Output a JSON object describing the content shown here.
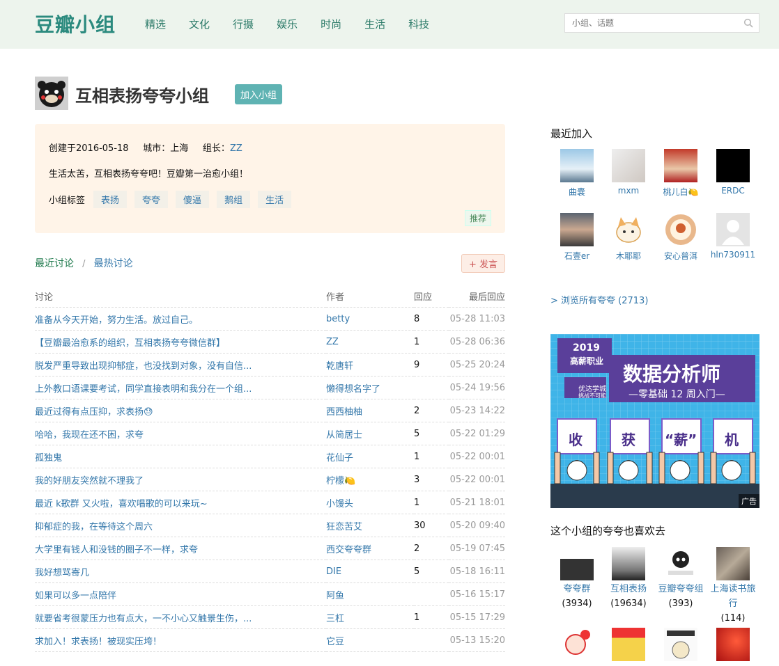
{
  "header": {
    "logo": "豆瓣小组",
    "nav": [
      "精选",
      "文化",
      "行摄",
      "娱乐",
      "时尚",
      "生活",
      "科技"
    ],
    "search_placeholder": "小组、话题"
  },
  "group": {
    "title": "互相表扬夸夸小组",
    "join_label": "加入小组",
    "created_label": "创建于2016-05-18",
    "city_label": "城市：上海",
    "leader_label": "组长：",
    "leader_name": "ZZ",
    "description": "生活太苦，互相表扬夸夸吧！豆瓣第一治愈小组！",
    "tags_label": "小组标签",
    "tags": [
      "表扬",
      "夸夸",
      "傻逼",
      "鹅组",
      "生活"
    ],
    "recommend_label": "推荐"
  },
  "discussions": {
    "tab_recent": "最近讨论",
    "tab_sep": "/",
    "tab_hot": "最热讨论",
    "post_label": "+ 发言",
    "columns": [
      "讨论",
      "作者",
      "回应",
      "最后回应"
    ],
    "rows": [
      {
        "title": "准备从今天开始，努力生活。放过自己。",
        "author": "betty",
        "replies": "8",
        "last": "05-28 11:03"
      },
      {
        "title": "【豆瓣最治愈系的组织，互相表扬夸夸微信群】",
        "author": "ZZ",
        "replies": "1",
        "last": "05-28 06:36"
      },
      {
        "title": "脱发严重导致出现抑郁症，也没找到对象，没有自信...",
        "author": "乾唐轩",
        "replies": "9",
        "last": "05-25 20:24"
      },
      {
        "title": "上外教口语课要考试，同学直接表明和我分在一个组...",
        "author": "懒得想名字了",
        "replies": "",
        "last": "05-24 19:56"
      },
      {
        "title": "最近过得有点压抑，求表扬😓",
        "author": "西西柚柚",
        "replies": "2",
        "last": "05-23 14:22"
      },
      {
        "title": "哈哈，我现在还不困，求夸",
        "author": "从简居士",
        "replies": "5",
        "last": "05-22 01:29"
      },
      {
        "title": "孤独鬼",
        "author": "花仙子",
        "replies": "1",
        "last": "05-22 00:01"
      },
      {
        "title": "我的好朋友突然就不理我了",
        "author": "柠檬🍋",
        "replies": "3",
        "last": "05-22 00:01"
      },
      {
        "title": "最近 k歌群 又火啦，喜欢唱歌的可以来玩~",
        "author": "小馒头",
        "replies": "1",
        "last": "05-21 18:01"
      },
      {
        "title": "抑郁症的我，在等待这个周六",
        "author": "狂恋苦艾",
        "replies": "30",
        "last": "05-20 09:40"
      },
      {
        "title": "大学里有钱人和没钱的圈子不一样，求夸",
        "author": "西交夸夸群",
        "replies": "2",
        "last": "05-19 07:45"
      },
      {
        "title": "我好想骂寄几",
        "author": "DIE",
        "replies": "5",
        "last": "05-18 16:11"
      },
      {
        "title": "如果可以多一点陪伴",
        "author": "阿鱼",
        "replies": "",
        "last": "05-16 15:17"
      },
      {
        "title": "就要省考很蒙压力也有点大，一不小心又触景生伤，...",
        "author": "三杠",
        "replies": "1",
        "last": "05-15 17:29"
      },
      {
        "title": "求加入！求表扬！被现实压垮！",
        "author": "它豆",
        "replies": "",
        "last": "05-13 15:20"
      }
    ]
  },
  "sidebar": {
    "recent_title": "最近加入",
    "members": [
      {
        "name": "曲嚢",
        "color": "#9cc8e6"
      },
      {
        "name": "mxm",
        "color": "#d8d2cc"
      },
      {
        "name": "桃儿白🍋",
        "color": "#c23a2a"
      },
      {
        "name": "ERDC",
        "color": "#000000"
      },
      {
        "name": "石壹er",
        "color": "#5a6470"
      },
      {
        "name": "木耶耶",
        "color": "#f3e4c8"
      },
      {
        "name": "安心普洱",
        "color": "#e9b88c"
      },
      {
        "name": "hln730911",
        "color": "#e4e4e4"
      }
    ],
    "browse_all": "> 浏览所有夸夸 (2713)",
    "ad": {
      "year": "2019",
      "sub": "高薪职业",
      "brand": "优达学城",
      "brand_sub": "挑战不可能",
      "headline": "数据分析师",
      "subline": "—零基础 12 周入门—",
      "signs": [
        "收",
        "获",
        "“薪”",
        "机"
      ],
      "label": "广告"
    },
    "liked_title": "这个小组的夸夸也喜欢去",
    "liked": [
      {
        "name": "夸夸群",
        "count": "(3934)",
        "color": "#dcdcdc"
      },
      {
        "name": "互相表扬",
        "count": "(19634)",
        "color": "#cfcfcf"
      },
      {
        "name": "豆瓣夸夸组",
        "count": "(393)",
        "color": "#e8e8e8"
      },
      {
        "name": "上海读书旅行",
        "count": "(114)",
        "color": "#8a7f72"
      },
      {
        "name": "",
        "count": "",
        "color": "#f7e0d6"
      },
      {
        "name": "",
        "count": "",
        "color": "#f5d24a"
      },
      {
        "name": "",
        "count": "",
        "color": "#eeeeee"
      },
      {
        "name": "",
        "count": "",
        "color": "#c82222"
      }
    ]
  }
}
